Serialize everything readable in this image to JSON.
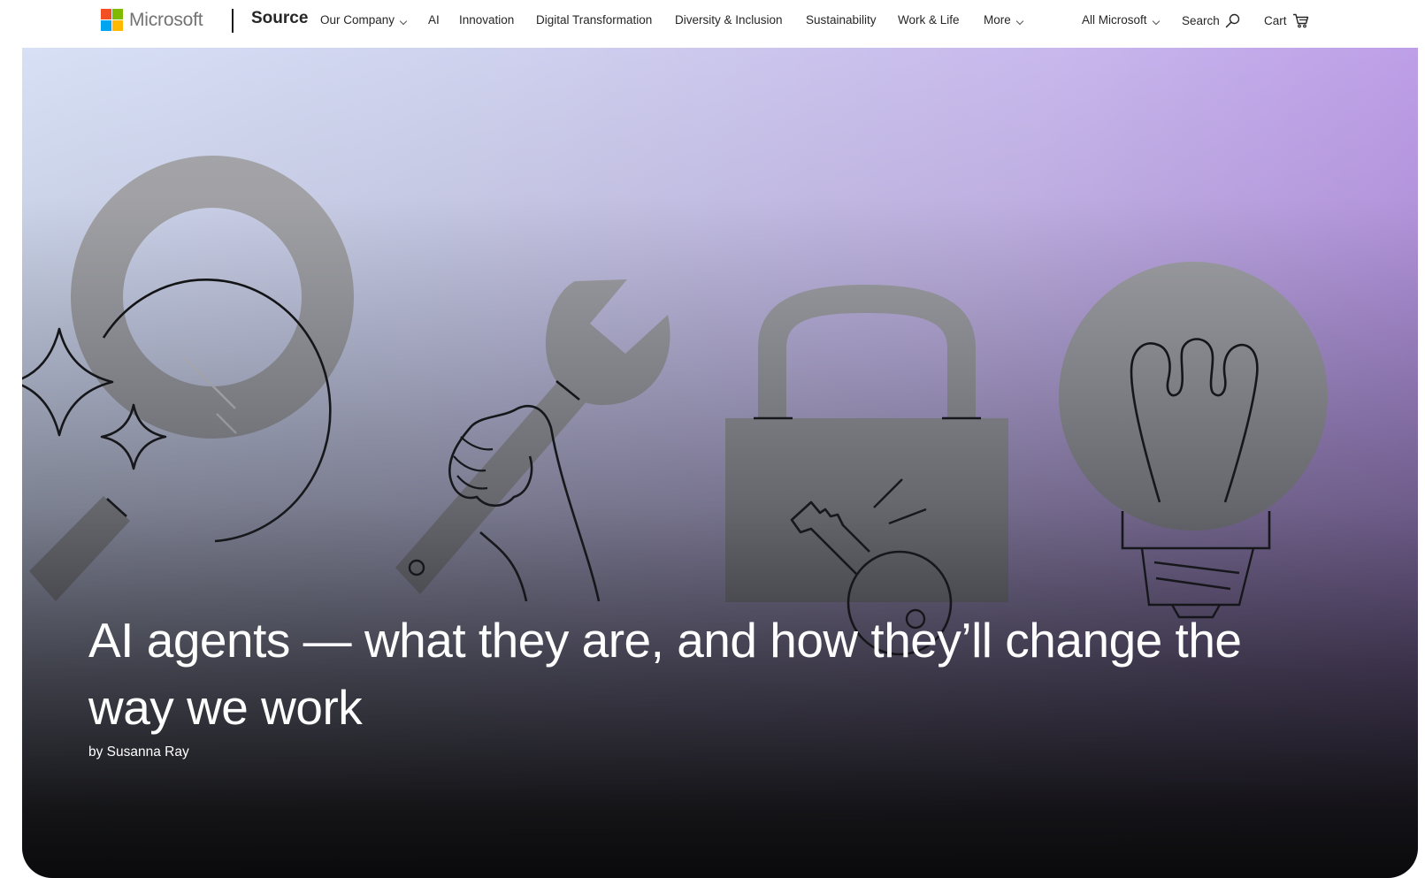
{
  "header": {
    "brand": "Microsoft",
    "section": "Source",
    "nav": {
      "our_company": "Our Company",
      "ai": "AI",
      "innovation": "Innovation",
      "digital_transformation": "Digital Transformation",
      "diversity_inclusion": "Diversity & Inclusion",
      "sustainability": "Sustainability",
      "work_life": "Work & Life",
      "more": "More"
    },
    "all_microsoft": "All Microsoft",
    "search": "Search",
    "cart": "Cart"
  },
  "hero": {
    "title": "AI agents — what they are, and how they’ll change the way we work",
    "byline": "by Susanna Ray",
    "icons": [
      "magnifier-icon",
      "sparkle-icon",
      "wrench-icon",
      "padlock-icon",
      "key-icon",
      "lightbulb-icon"
    ]
  },
  "colors": {
    "logo_red": "#f25022",
    "logo_green": "#7fba00",
    "logo_blue": "#00a4ef",
    "logo_yellow": "#ffb900",
    "hero_gradient_light": "#d7e0f5",
    "hero_gradient_purple": "#b68ce4",
    "hero_dark": "#0e0e10",
    "nav_text": "#262626"
  }
}
